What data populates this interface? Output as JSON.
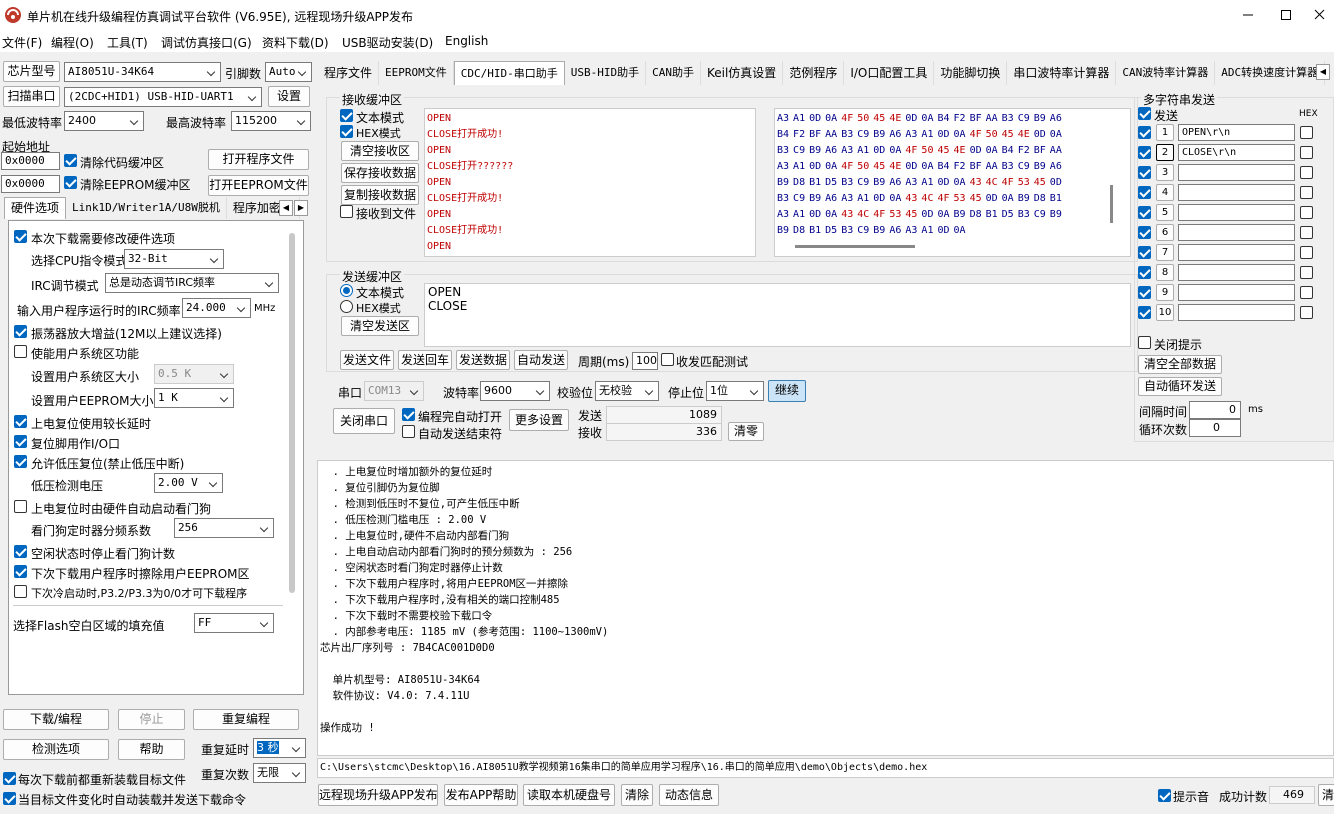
{
  "window": {
    "title": "单片机在线升级编程仿真调试平台软件 (V6.95E), 远程现场升级APP发布"
  },
  "menu": [
    "文件(F)",
    "编程(O)",
    "工具(T)",
    "调试仿真接口(G)",
    "资料下载(D)",
    "USB驱动安装(D)",
    "English"
  ],
  "left": {
    "chip_label": "芯片型号",
    "chip_value": "AI8051U-34K64",
    "pin_label": "引脚数",
    "pin_value": "Auto",
    "scan_button": "扫描串口",
    "port_value": "(2CDC+HID1) USB-HID-UART1",
    "settings_button": "设置",
    "min_baud_label": "最低波特率",
    "min_baud": "2400",
    "max_baud_label": "最高波特率",
    "max_baud": "115200",
    "start_addr_label": "起始地址",
    "addr1": "0x0000",
    "clear_code": "清除代码缓冲区",
    "open_program": "打开程序文件",
    "addr2": "0x0000",
    "clear_eeprom": "清除EEPROM缓冲区",
    "open_eeprom": "打开EEPROM文件",
    "tabs": [
      "硬件选项",
      "Link1D/Writer1A/U8W脱机",
      "程序加密后"
    ],
    "hw": {
      "opt1": "本次下载需要修改硬件选项",
      "cpu_label": "选择CPU指令模式",
      "cpu_value": "32-Bit",
      "irc_mode_label": "IRC调节模式",
      "irc_mode_value": "总是动态调节IRC频率",
      "irc_freq_label": "输入用户程序运行时的IRC频率",
      "irc_freq_value": "24.000",
      "mhz": "MHz",
      "osc_gain": "振荡器放大增益(12M以上建议选择)",
      "sys_area": "使能用户系统区功能",
      "sys_size_label": "设置用户系统区大小",
      "sys_size_value": "0.5 K",
      "eeprom_size_label": "设置用户EEPROM大小",
      "eeprom_size_value": "1   K",
      "long_delay": "上电复位使用较长延时",
      "reset_io": "复位脚用作I/O口",
      "lvd_reset": "允许低压复位(禁止低压中断)",
      "lvd_label": "低压检测电压",
      "lvd_value": "2.00 V",
      "wdt_auto": "上电复位时由硬件自动启动看门狗",
      "wdt_div_label": "看门狗定时器分频系数",
      "wdt_div_value": "256",
      "idle_wdt": "空闲状态时停止看门狗计数",
      "erase_eeprom": "下次下载用户程序时擦除用户EEPROM区",
      "cold_p32": "下次冷启动时,P3.2/P3.3为0/0才可下载程序",
      "flash_fill_label": "选择Flash空白区域的填充值",
      "flash_fill_value": "FF"
    },
    "download": "下载/编程",
    "stop": "停止",
    "re_program": "重复编程",
    "check": "检测选项",
    "help": "帮助",
    "repeat_delay_label": "重复延时",
    "repeat_delay": "3 秒",
    "repeat_count_label": "重复次数",
    "repeat_count": "无限",
    "reload_each": "每次下载前都重新装载目标文件",
    "auto_reload": "当目标文件变化时自动装载并发送下载命令"
  },
  "right_tabs": [
    "程序文件",
    "EEPROM文件",
    "CDC/HID-串口助手",
    "USB-HID助手",
    "CAN助手",
    "Keil仿真设置",
    "范例程序",
    "I/O口配置工具",
    "功能脚切换",
    "串口波特率计算器",
    "CAN波特率计算器",
    "ADC转换速度计算器"
  ],
  "recv": {
    "title": "接收缓冲区",
    "text_mode": "文本模式",
    "hex_mode": "HEX模式",
    "clear": "清空接收区",
    "save": "保存接收数据",
    "copy": "复制接收数据",
    "to_file": "接收到文件",
    "text_lines": [
      {
        "a": "OPEN",
        "b": ""
      },
      {
        "a": "CLOSE",
        "b": "打开成功!"
      },
      {
        "a": "OPEN",
        "b": ""
      },
      {
        "a": "CLOSE",
        "b": "打开??????"
      },
      {
        "a": "OPEN",
        "b": ""
      },
      {
        "a": "CLOSE",
        "b": "打开成功!"
      },
      {
        "a": "OPEN",
        "b": ""
      },
      {
        "a": "CLOSE",
        "b": "打开成功!"
      },
      {
        "a": "OPEN",
        "b": ""
      }
    ],
    "hex_lines": [
      [
        "A3",
        "A1",
        "0D",
        "0A",
        "4F",
        "50",
        "45",
        "4E",
        "0D",
        "0A",
        "B4",
        "F2",
        "BF",
        "AA",
        "B3",
        "C9",
        "B9",
        "A6"
      ],
      [
        "B4",
        "F2",
        "BF",
        "AA",
        "B3",
        "C9",
        "B9",
        "A6",
        "A3",
        "A1",
        "0D",
        "0A",
        "4F",
        "50",
        "45",
        "4E",
        "0D",
        "0A"
      ],
      [
        "B3",
        "C9",
        "B9",
        "A6",
        "A3",
        "A1",
        "0D",
        "0A",
        "4F",
        "50",
        "45",
        "4E",
        "0D",
        "0A",
        "B4",
        "F2",
        "BF",
        "AA"
      ],
      [
        "A3",
        "A1",
        "0D",
        "0A",
        "4F",
        "50",
        "45",
        "4E",
        "0D",
        "0A",
        "B4",
        "F2",
        "BF",
        "AA",
        "B3",
        "C9",
        "B9",
        "A6"
      ],
      [
        "B9",
        "D8",
        "B1",
        "D5",
        "B3",
        "C9",
        "B9",
        "A6",
        "A3",
        "A1",
        "0D",
        "0A",
        "43",
        "4C",
        "4F",
        "53",
        "45",
        "0D"
      ],
      [
        "B3",
        "C9",
        "B9",
        "A6",
        "A3",
        "A1",
        "0D",
        "0A",
        "43",
        "4C",
        "4F",
        "53",
        "45",
        "0D",
        "0A",
        "B9",
        "D8",
        "B1"
      ],
      [
        "A3",
        "A1",
        "0D",
        "0A",
        "43",
        "4C",
        "4F",
        "53",
        "45",
        "0D",
        "0A",
        "B9",
        "D8",
        "B1",
        "D5",
        "B3",
        "C9",
        "B9"
      ],
      [
        "B9",
        "D8",
        "B1",
        "D5",
        "B3",
        "C9",
        "B9",
        "A6",
        "A3",
        "A1",
        "0D",
        "0A"
      ]
    ]
  },
  "send": {
    "title": "发送缓冲区",
    "text_mode": "文本模式",
    "hex_mode": "HEX模式",
    "clear": "清空发送区",
    "lines": [
      "OPEN",
      "CLOSE"
    ],
    "send_file": "发送文件",
    "send_enter": "发送回车",
    "send_data": "发送数据",
    "auto_send": "自动发送",
    "period_label": "周期(ms)",
    "period": "100",
    "match_test": "收发匹配测试"
  },
  "port_bar": {
    "port_label": "串口",
    "port": "COM13",
    "baud_label": "波特率",
    "baud": "9600",
    "parity_label": "校验位",
    "parity": "无校验",
    "stop_label": "停止位",
    "stop": "1位",
    "continue": "继续",
    "close_port": "关闭串口",
    "auto_open": "编程完自动打开",
    "auto_end": "自动发送结束符",
    "more": "更多设置",
    "sent_label": "发送",
    "sent": "1089",
    "recv_label": "接收",
    "recv": "336",
    "clear": "清零"
  },
  "multi": {
    "title": "多字符串发送",
    "send": "发送",
    "hex": "HEX",
    "rows": [
      {
        "n": "1",
        "v": "OPEN\\r\\n"
      },
      {
        "n": "2",
        "v": "CLOSE\\r\\n"
      },
      {
        "n": "3",
        "v": ""
      },
      {
        "n": "4",
        "v": ""
      },
      {
        "n": "5",
        "v": ""
      },
      {
        "n": "6",
        "v": ""
      },
      {
        "n": "7",
        "v": ""
      },
      {
        "n": "8",
        "v": ""
      },
      {
        "n": "9",
        "v": ""
      },
      {
        "n": "10",
        "v": ""
      }
    ],
    "close_tip": "关闭提示",
    "clear_all": "清空全部数据",
    "auto_loop": "自动循环发送",
    "interval_label": "间隔时间",
    "interval": "0",
    "ms": "ms",
    "loop_label": "循环次数",
    "loop": "0"
  },
  "log": {
    "lines": [
      "  . 上电复位时增加额外的复位延时",
      "  . 复位引脚仍为复位脚",
      "  . 检测到低压时不复位,可产生低压中断",
      "  . 低压检测门槛电压 : 2.00 V",
      "  . 上电复位时,硬件不启动内部看门狗",
      "  . 上电自动启动内部看门狗时的预分频数为 : 256",
      "  . 空闲状态时看门狗定时器停止计数",
      "  . 下次下载用户程序时,将用户EEPROM区一并擦除",
      "  . 下次下载用户程序时,没有相关的端口控制485",
      "  . 下次下载时不需要校验下载口令",
      "  . 内部参考电压: 1185 mV (参考范围: 1100~1300mV)",
      "芯片出厂序列号 : 7B4CAC001D0D0",
      "",
      "  单片机型号: AI8051U-34K64",
      "  软件协议: V4.0: 7.4.11U",
      "",
      "操作成功 !"
    ]
  },
  "path": "C:\\Users\\stcmc\\Desktop\\16.AI8051U教学视频第16集串口的简单应用学习程序\\16.串口的简单应用\\demo\\Objects\\demo.hex",
  "bottom": {
    "remote": "远程现场升级APP发布",
    "publish_help": "发布APP帮助",
    "read_disk": "读取本机硬盘号",
    "clear": "清除",
    "dynamic": "动态信息",
    "beep": "提示音",
    "success_label": "成功计数",
    "success": "469",
    "clear_right": "清零"
  },
  "colors": {
    "accent": "#0067c0",
    "recv_red": "#c00000"
  }
}
